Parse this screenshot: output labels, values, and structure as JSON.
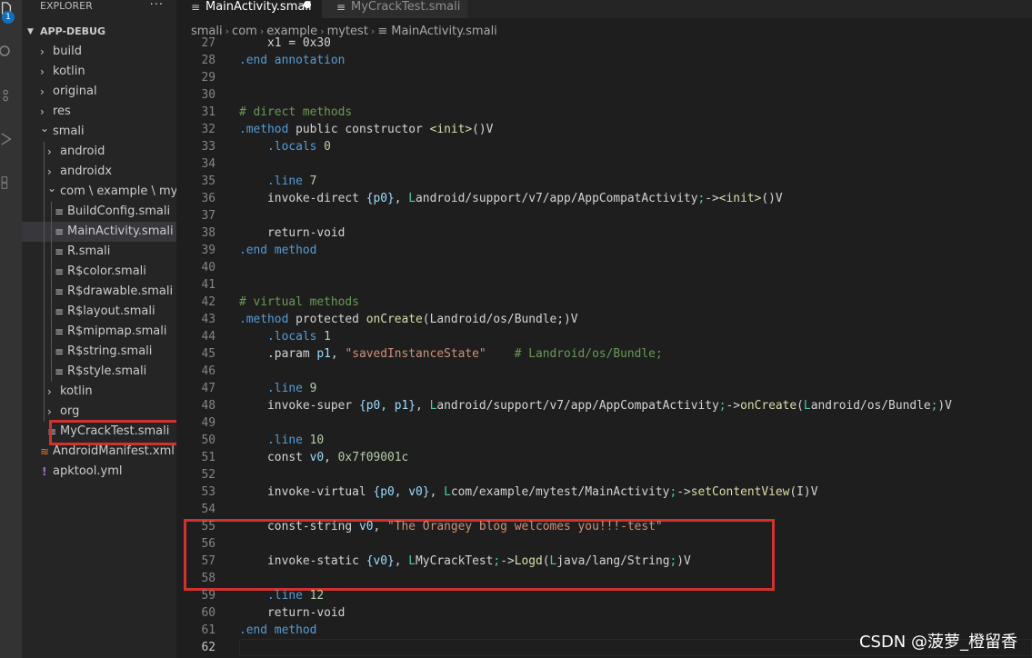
{
  "sidebar": {
    "title": "EXPLORER",
    "more": "···",
    "section": "APP-DEBUG",
    "badge": "1",
    "items": [
      {
        "label": "build",
        "depth": 0,
        "kind": "folder",
        "expanded": false
      },
      {
        "label": "kotlin",
        "depth": 0,
        "kind": "folder",
        "expanded": false
      },
      {
        "label": "original",
        "depth": 0,
        "kind": "folder",
        "expanded": false
      },
      {
        "label": "res",
        "depth": 0,
        "kind": "folder",
        "expanded": false
      },
      {
        "label": "smali",
        "depth": 0,
        "kind": "folder",
        "expanded": true
      },
      {
        "label": "android",
        "depth": 1,
        "kind": "folder",
        "expanded": false
      },
      {
        "label": "androidx",
        "depth": 1,
        "kind": "folder",
        "expanded": false
      },
      {
        "label": "com \\ example \\ myt...",
        "depth": 1,
        "kind": "folder",
        "expanded": true
      },
      {
        "label": "BuildConfig.smali",
        "depth": 2,
        "kind": "file"
      },
      {
        "label": "MainActivity.smali",
        "depth": 2,
        "kind": "file",
        "selected": true
      },
      {
        "label": "R.smali",
        "depth": 2,
        "kind": "file"
      },
      {
        "label": "R$color.smali",
        "depth": 2,
        "kind": "file"
      },
      {
        "label": "R$drawable.smali",
        "depth": 2,
        "kind": "file"
      },
      {
        "label": "R$layout.smali",
        "depth": 2,
        "kind": "file"
      },
      {
        "label": "R$mipmap.smali",
        "depth": 2,
        "kind": "file"
      },
      {
        "label": "R$string.smali",
        "depth": 2,
        "kind": "file"
      },
      {
        "label": "R$style.smali",
        "depth": 2,
        "kind": "file"
      },
      {
        "label": "kotlin",
        "depth": 1,
        "kind": "folder",
        "expanded": false
      },
      {
        "label": "org",
        "depth": 1,
        "kind": "folder",
        "expanded": false
      },
      {
        "label": "MyCrackTest.smali",
        "depth": 1,
        "kind": "file",
        "highlighted": true
      },
      {
        "label": "AndroidManifest.xml",
        "depth": 0,
        "kind": "xml"
      },
      {
        "label": "apktool.yml",
        "depth": 0,
        "kind": "yml"
      }
    ]
  },
  "tabs": [
    {
      "label": "MainActivity.smali",
      "active": true,
      "dirty": true
    },
    {
      "label": "MyCrackTest.smali",
      "active": false
    }
  ],
  "breadcrumb": [
    "smali",
    "com",
    "example",
    "mytest",
    "MainActivity.smali"
  ],
  "editor": {
    "first_line": 27,
    "current_line": 62,
    "lines": [
      [
        [
          "    x1 = 0x30",
          "kw"
        ]
      ],
      [
        [
          ".end annotation",
          "dir"
        ]
      ],
      [],
      [],
      [
        [
          "# direct methods",
          "comment"
        ]
      ],
      [
        [
          ".method ",
          "dir"
        ],
        [
          "public constructor ",
          "kw"
        ],
        [
          "<init>",
          "fn"
        ],
        [
          "()V",
          "punc"
        ]
      ],
      [
        [
          "    .locals ",
          "dir"
        ],
        [
          "0",
          "num"
        ]
      ],
      [],
      [
        [
          "    .line ",
          "dir"
        ],
        [
          "7",
          "num"
        ]
      ],
      [
        [
          "    invoke-direct ",
          "kw"
        ],
        [
          "{p0}",
          "reg"
        ],
        [
          ", ",
          "punc"
        ],
        [
          "L",
          "type"
        ],
        [
          "android/support/v7/app/AppCompatActivity",
          "kw"
        ],
        [
          ";",
          "type"
        ],
        [
          "->",
          "punc"
        ],
        [
          "<init>",
          "fn"
        ],
        [
          "()V",
          "punc"
        ]
      ],
      [],
      [
        [
          "    return-void",
          "kw"
        ]
      ],
      [
        [
          ".end method",
          "dir"
        ]
      ],
      [],
      [],
      [
        [
          "# virtual methods",
          "comment"
        ]
      ],
      [
        [
          ".method ",
          "dir"
        ],
        [
          "protected ",
          "kw"
        ],
        [
          "onCreate",
          "fn"
        ],
        [
          "(",
          "punc"
        ],
        [
          "Landroid/os/Bundle;",
          "kw"
        ],
        [
          ")V",
          "punc"
        ]
      ],
      [
        [
          "    .locals ",
          "dir"
        ],
        [
          "1",
          "num"
        ]
      ],
      [
        [
          "    .param ",
          "kw"
        ],
        [
          "p1",
          "reg"
        ],
        [
          ", ",
          "punc"
        ],
        [
          "\"savedInstanceState\"",
          "str"
        ],
        [
          "    # Landroid/os/Bundle;",
          "comment"
        ]
      ],
      [],
      [
        [
          "    .line ",
          "dir"
        ],
        [
          "9",
          "num"
        ]
      ],
      [
        [
          "    invoke-super ",
          "kw"
        ],
        [
          "{p0, p1}",
          "reg"
        ],
        [
          ", ",
          "punc"
        ],
        [
          "L",
          "type"
        ],
        [
          "android/support/v7/app/AppCompatActivity",
          "kw"
        ],
        [
          ";",
          "type"
        ],
        [
          "->",
          "punc"
        ],
        [
          "onCreate",
          "fn"
        ],
        [
          "(",
          "punc"
        ],
        [
          "L",
          "type"
        ],
        [
          "android/os/Bundle",
          "kw"
        ],
        [
          ";",
          "type"
        ],
        [
          ")V",
          "punc"
        ]
      ],
      [],
      [
        [
          "    .line ",
          "dir"
        ],
        [
          "10",
          "num"
        ]
      ],
      [
        [
          "    const ",
          "kw"
        ],
        [
          "v0",
          "reg"
        ],
        [
          ", ",
          "punc"
        ],
        [
          "0x7f09001c",
          "num"
        ]
      ],
      [],
      [
        [
          "    invoke-virtual ",
          "kw"
        ],
        [
          "{p0, v0}",
          "reg"
        ],
        [
          ", ",
          "punc"
        ],
        [
          "L",
          "type"
        ],
        [
          "com/example/mytest/MainActivity",
          "kw"
        ],
        [
          ";",
          "type"
        ],
        [
          "->",
          "punc"
        ],
        [
          "setContentView",
          "fn"
        ],
        [
          "(I)V",
          "punc"
        ]
      ],
      [],
      [
        [
          "    const-string ",
          "kw"
        ],
        [
          "v0",
          "reg"
        ],
        [
          ", ",
          "punc"
        ],
        [
          "\"The Orangey blog welcomes you!!!-test\"",
          "str"
        ]
      ],
      [],
      [
        [
          "    invoke-static ",
          "kw"
        ],
        [
          "{v0}",
          "reg"
        ],
        [
          ", ",
          "punc"
        ],
        [
          "L",
          "type"
        ],
        [
          "MyCrackTest",
          "kw"
        ],
        [
          ";",
          "type"
        ],
        [
          "->",
          "punc"
        ],
        [
          "Logd",
          "fn"
        ],
        [
          "(",
          "punc"
        ],
        [
          "L",
          "type"
        ],
        [
          "java/lang/String",
          "kw"
        ],
        [
          ";",
          "type"
        ],
        [
          ")V",
          "punc"
        ]
      ],
      [],
      [
        [
          "    .line ",
          "dir"
        ],
        [
          "12",
          "num"
        ]
      ],
      [
        [
          "    return-void",
          "kw"
        ]
      ],
      [
        [
          ".end method",
          "dir"
        ]
      ],
      []
    ]
  },
  "watermark": "CSDN @菠萝_橙留香",
  "colors": {
    "background": "#1e1e1e",
    "sidebar": "#252526",
    "highlight_box": "#d2322d"
  }
}
